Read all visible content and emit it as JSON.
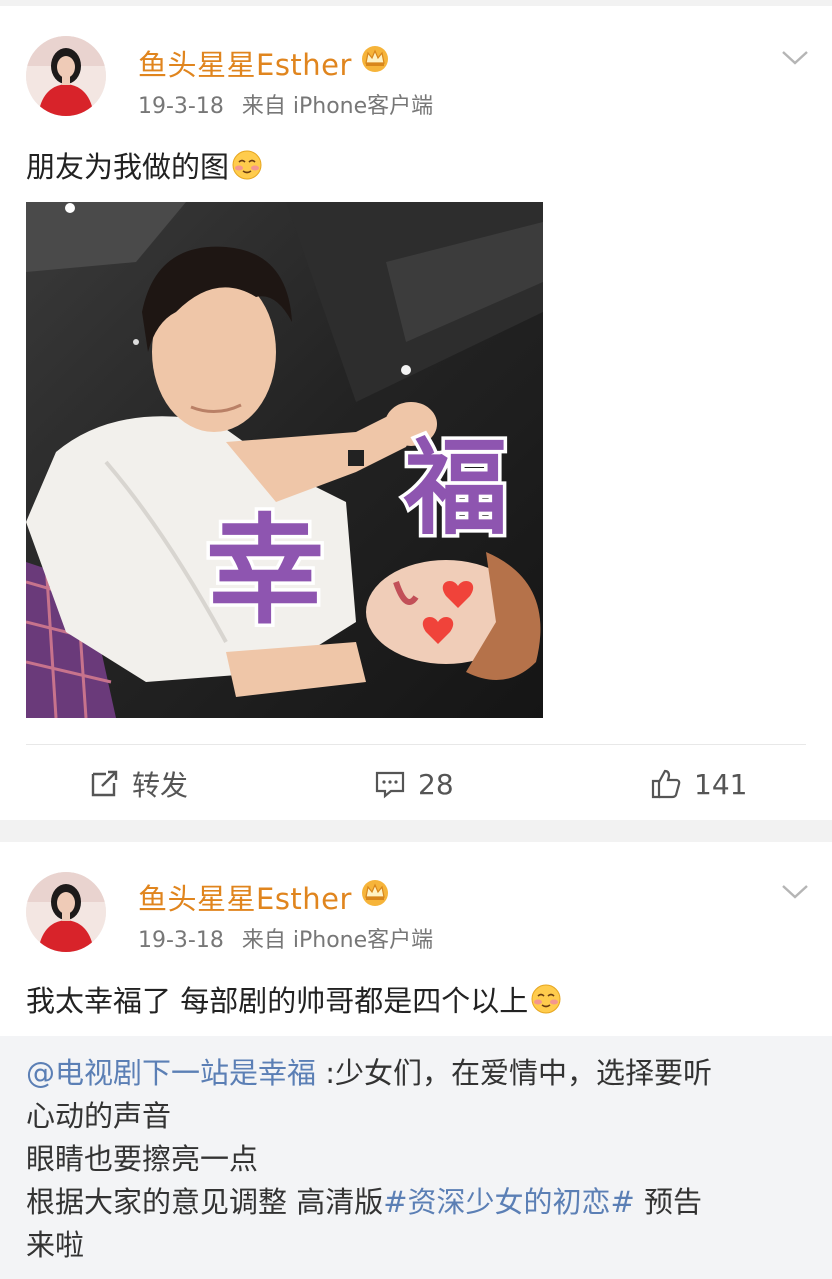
{
  "posts": [
    {
      "username": "鱼头星星Esther",
      "date": "19-3-18",
      "source": "来自 iPhone客户端",
      "text": "朋友为我做的图",
      "text_emoji": "shy-smile-emoji",
      "photo": {
        "overlay_char_1": "幸",
        "overlay_char_2": "福"
      },
      "actions": {
        "repost_label": "转发",
        "comment_count": "28",
        "like_count": "141"
      }
    },
    {
      "username": "鱼头星星Esther",
      "date": "19-3-18",
      "source": "来自 iPhone客户端",
      "text": "我太幸福了 每部剧的帅哥都是四个以上",
      "text_emoji": "shy-smile-emoji",
      "repost": {
        "mention": "@电视剧下一站是幸福",
        "line1_rest": " :少女们，在爱情中，选择要听",
        "line2": "心动的声音",
        "line3": "眼睛也要擦亮一点",
        "line4_pre": "根据大家的意见调整 高清版",
        "hashtag": "#资深少女的初恋#",
        "line4_post": " 预告",
        "line5": "来啦"
      }
    }
  ],
  "colors": {
    "username": "#e0851e",
    "link": "#5b7fb5",
    "overlay_text": "#8e55b0"
  },
  "icons": [
    "crown-vip-icon",
    "chevron-down-icon",
    "repost-icon",
    "comment-icon",
    "like-icon"
  ]
}
